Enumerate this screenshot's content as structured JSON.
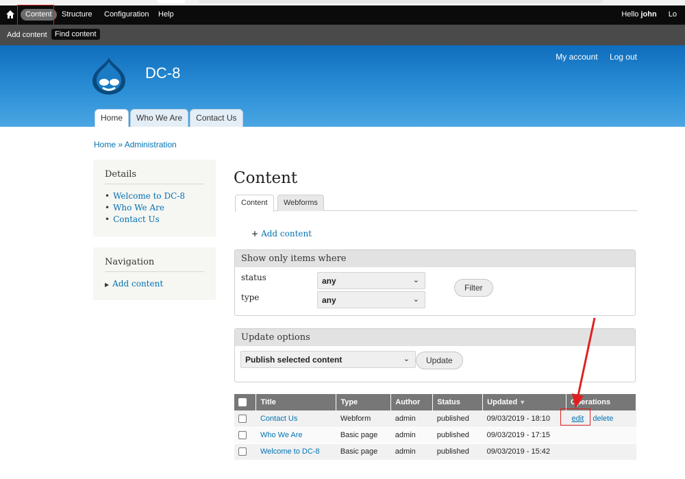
{
  "toolbar": {
    "items": [
      "Content",
      "Structure",
      "Configuration",
      "Help"
    ],
    "hello_prefix": "Hello ",
    "user": "john",
    "logout_cut": "Lo"
  },
  "shortcuts": [
    "Add content",
    "Find content"
  ],
  "header": {
    "site_name": "DC-8",
    "secondary": [
      "My account",
      "Log out"
    ],
    "tabs": [
      "Home",
      "Who We Are",
      "Contact Us"
    ]
  },
  "breadcrumb": "Home » Administration",
  "sidebar": {
    "details": {
      "title": "Details",
      "items": [
        "Welcome to DC-8",
        "Who We Are",
        "Contact Us"
      ]
    },
    "navigation": {
      "title": "Navigation",
      "items": [
        "Add content"
      ]
    }
  },
  "main": {
    "title": "Content",
    "tabs": [
      "Content",
      "Webforms"
    ],
    "add_content": "Add content",
    "filters": {
      "legend": "Show only items where",
      "status_label": "status",
      "status_value": "any",
      "type_label": "type",
      "type_value": "any",
      "filter_button": "Filter"
    },
    "update": {
      "legend": "Update options",
      "selected": "Publish selected content",
      "button": "Update"
    },
    "table": {
      "headers": [
        "Title",
        "Type",
        "Author",
        "Status",
        "Updated",
        "Operations"
      ],
      "rows": [
        {
          "title": "Contact Us",
          "type": "Webform",
          "author": "admin",
          "status": "published",
          "updated": "09/03/2019 - 18:10",
          "ops": [
            "edit",
            "delete"
          ]
        },
        {
          "title": "Who We Are",
          "type": "Basic page",
          "author": "admin",
          "status": "published",
          "updated": "09/03/2019 - 17:15",
          "ops": []
        },
        {
          "title": "Welcome to DC-8",
          "type": "Basic page",
          "author": "admin",
          "status": "published",
          "updated": "09/03/2019 - 15:42",
          "ops": []
        }
      ]
    }
  },
  "colors": {
    "toolbar_bg": "#0b0b0b",
    "header_top": "#0f6dbd",
    "link": "#0071b3",
    "highlight": "#e02020"
  }
}
